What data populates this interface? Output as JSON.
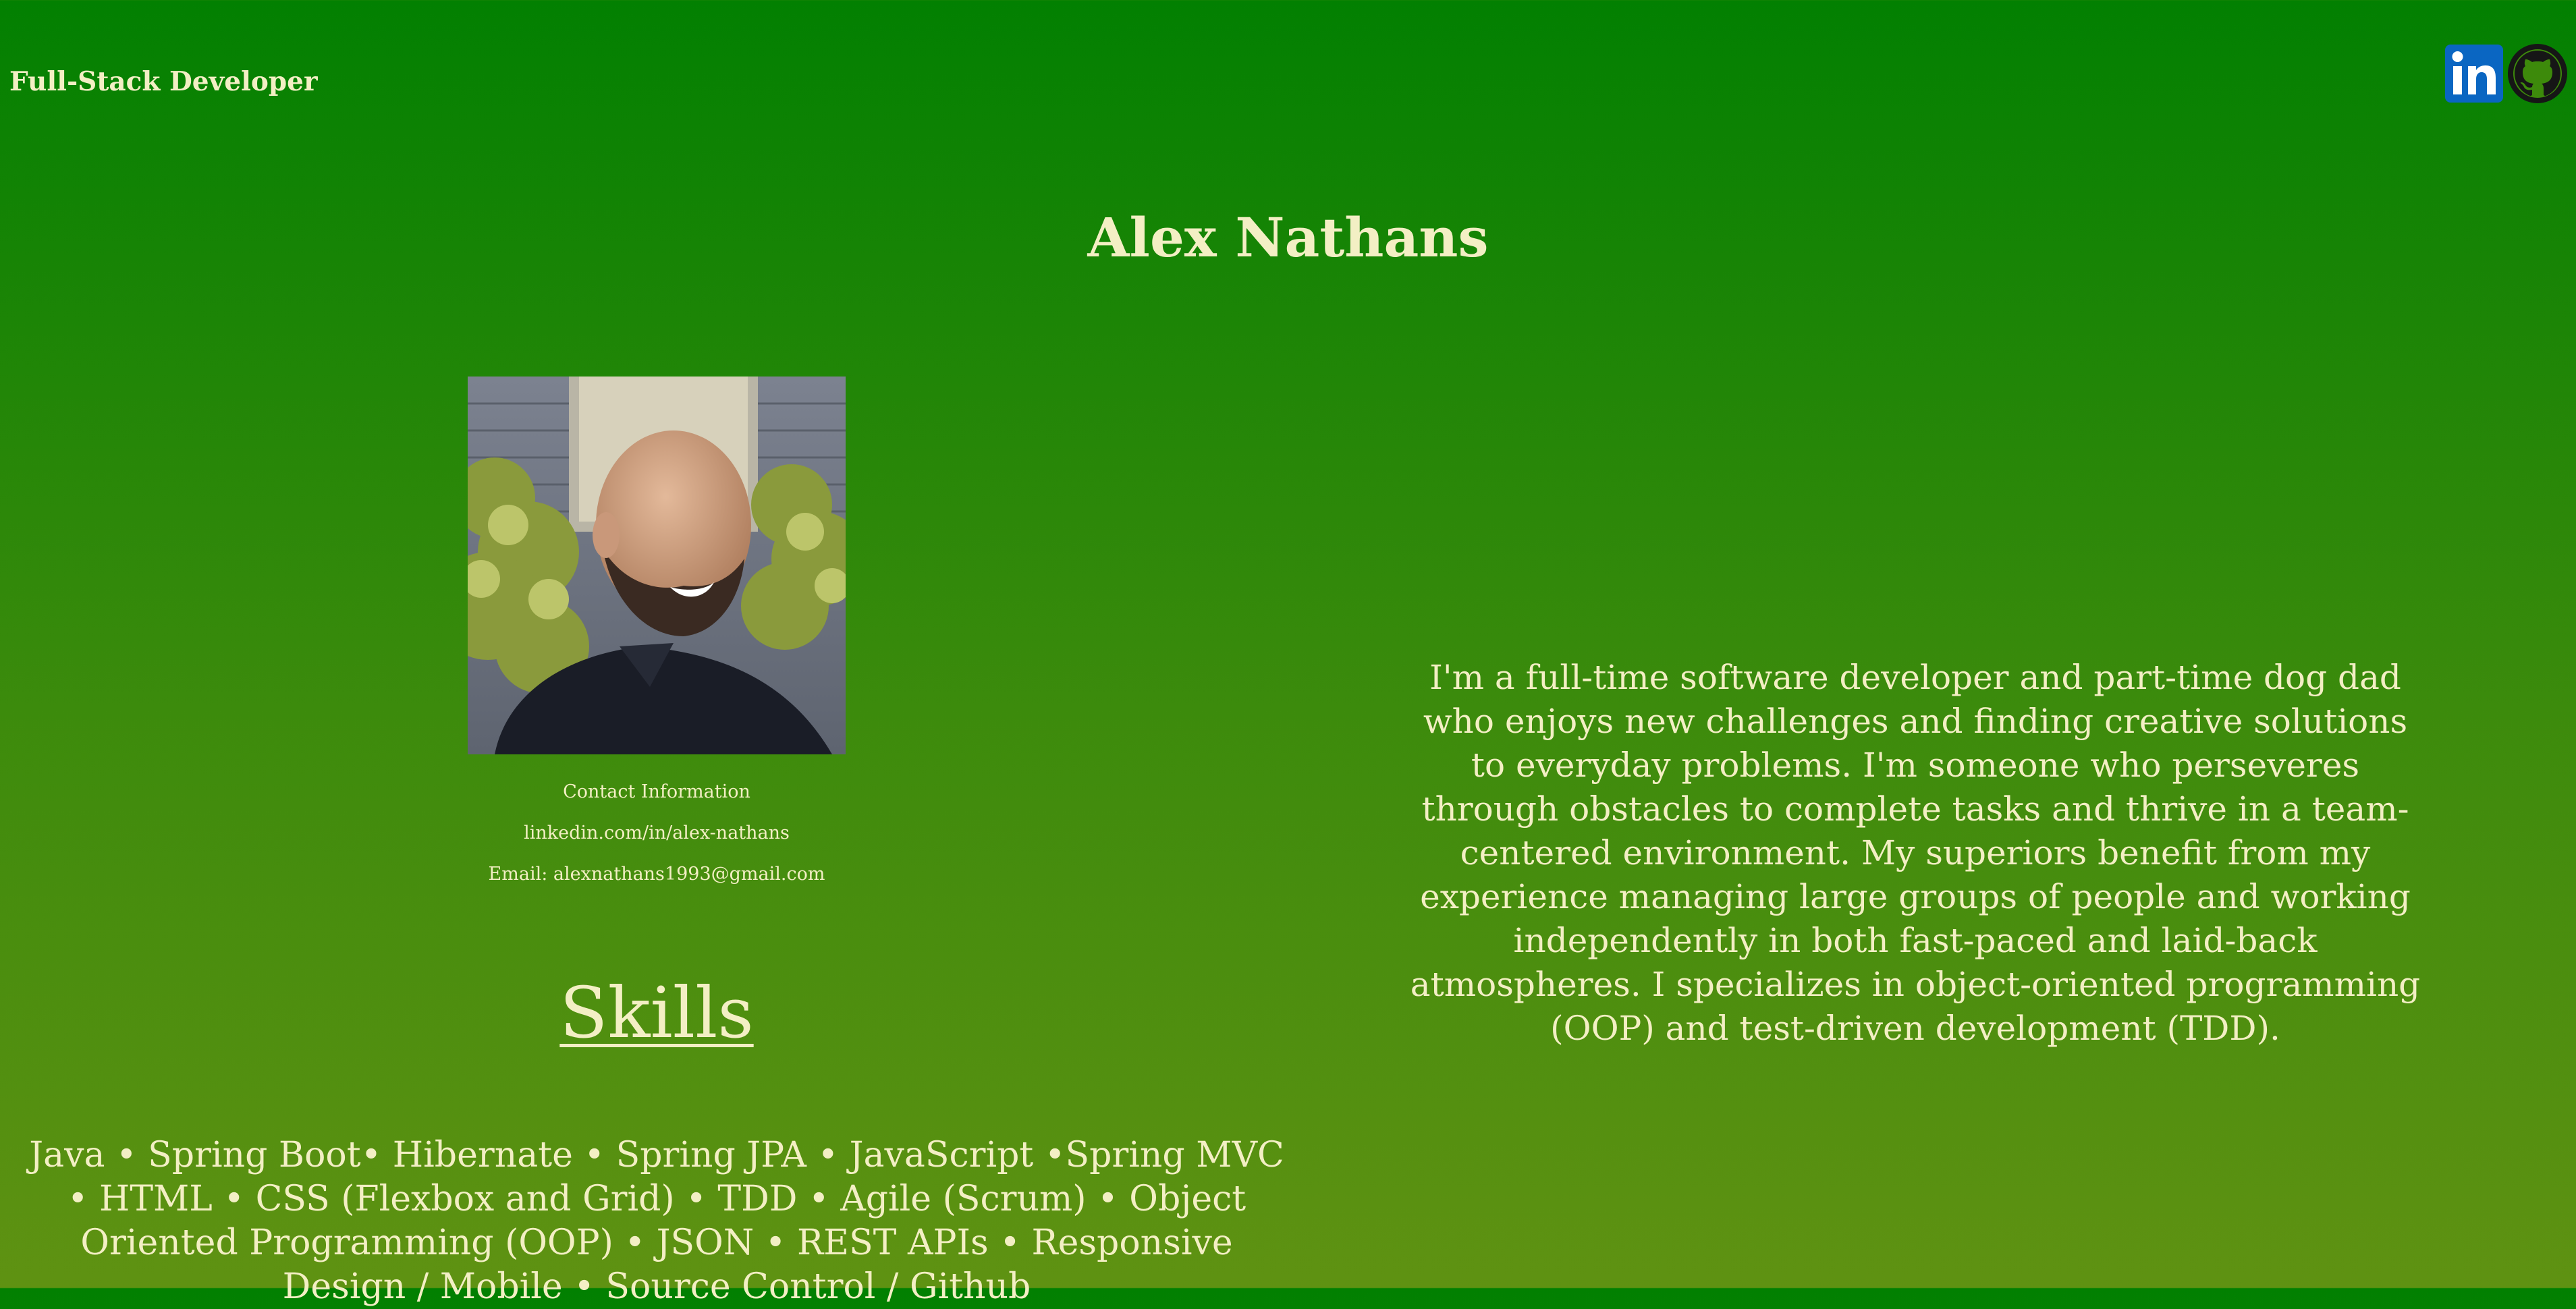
{
  "header": {
    "role": "Full-Stack Developer",
    "social": [
      {
        "name": "linkedin-icon",
        "label": "LinkedIn"
      },
      {
        "name": "github-icon",
        "label": "GitHub"
      }
    ]
  },
  "hero": {
    "name": "Alex Nathans"
  },
  "contact": {
    "heading": "Contact Information",
    "linkedin": "linkedin.com/in/alex-nathans",
    "email": "Email: alexnathans1993@gmail.com"
  },
  "skills": {
    "heading": "Skills",
    "list": "Java • Spring Boot• Hibernate • Spring JPA • JavaScript •Spring MVC • HTML • CSS (Flexbox and Grid) • TDD • Agile (Scrum) • Object Oriented Programming (OOP) • JSON • REST APIs • Responsive Design / Mobile • Source Control / Github"
  },
  "about": {
    "text": "I'm a full-time software developer and part-time dog dad who enjoys new challenges and finding creative solutions to everyday problems. I'm someone who perseveres through obstacles to complete tasks and thrive in a team-centered environment. My superiors benefit from my experience managing large groups of people and working independently in both fast-paced and laid-back atmospheres. I specializes in object-oriented programming (OOP) and test-driven development (TDD)."
  },
  "colors": {
    "background_top": "#028001",
    "background_bottom": "#5f9212",
    "text": "#f3efc4",
    "linkedin_blue": "#0a66c2"
  }
}
